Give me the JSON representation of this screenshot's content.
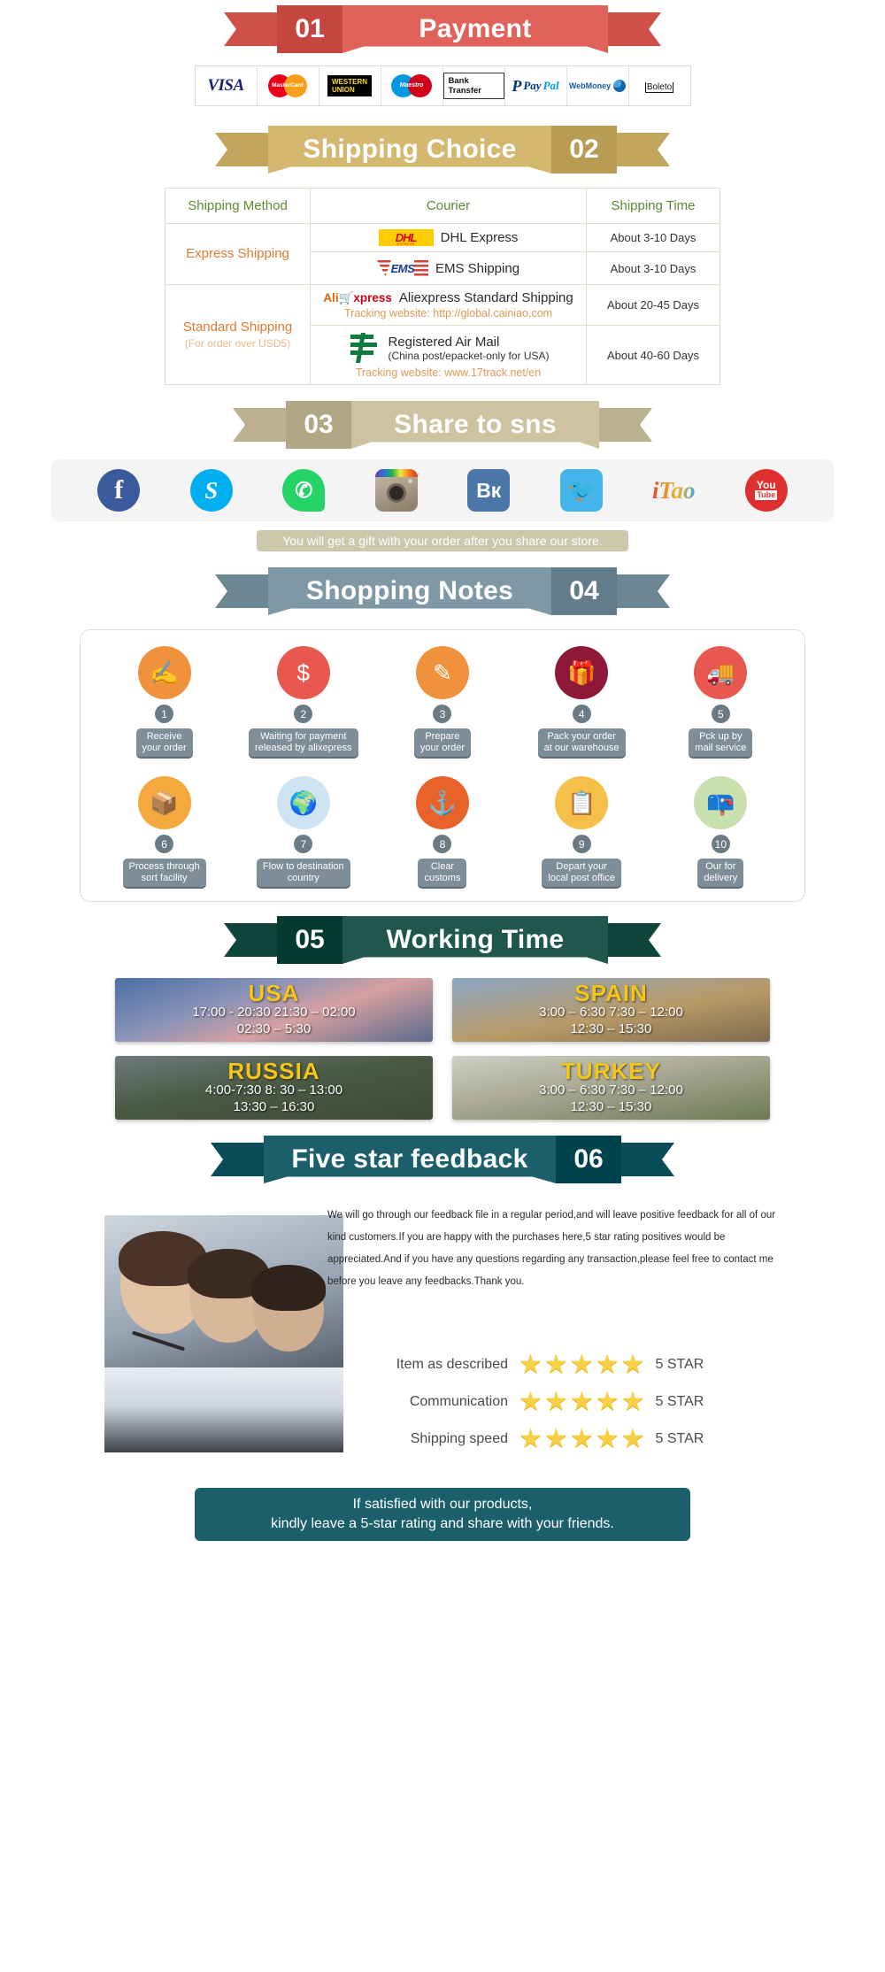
{
  "sections": {
    "payment": {
      "number": "01",
      "title": "Payment",
      "color": "#e0625a",
      "methods": [
        {
          "name": "visa-logo",
          "label": "VISA"
        },
        {
          "name": "mastercard-logo",
          "label": "MasterCard"
        },
        {
          "name": "western-union-logo",
          "line1": "WESTERN",
          "line2": "UNION"
        },
        {
          "name": "maestro-logo",
          "label": "Maestro"
        },
        {
          "name": "bank-transfer-logo",
          "label": "Bank Transfer"
        },
        {
          "name": "paypal-logo",
          "label": "PayPal",
          "part1": "Pay",
          "part2": "Pal"
        },
        {
          "name": "webmoney-logo",
          "label": "WebMoney"
        },
        {
          "name": "boleto-logo",
          "label": "Boleto"
        }
      ]
    },
    "shipping": {
      "number": "02",
      "title": "Shipping Choice",
      "color": "#d4b870",
      "headers": [
        "Shipping Method",
        "Courier",
        "Shipping Time"
      ],
      "groups": [
        {
          "method": "Express Shipping",
          "method_sub": "",
          "rows": [
            {
              "logo": "dhl",
              "courier": "DHL Express",
              "courier_sub": "",
              "track": "",
              "time": "About 3-10 Days"
            },
            {
              "logo": "ems",
              "courier": "EMS Shipping",
              "courier_sub": "",
              "track": "",
              "time": "About 3-10 Days"
            }
          ]
        },
        {
          "method": "Standard Shipping",
          "method_sub": "(For order over USD5)",
          "rows": [
            {
              "logo": "aliexpress",
              "courier": "Aliexpress Standard Shipping",
              "courier_sub": "",
              "track": "Tracking website: http://global.cainiao.com",
              "time": "About 20-45 Days"
            },
            {
              "logo": "chinapost",
              "courier": "Registered Air Mail",
              "courier_sub": "(China post/epacket-only for USA)",
              "track": "Tracking website: www.17track.net/en",
              "time": "About 40-60 Days"
            }
          ]
        }
      ]
    },
    "share": {
      "number": "03",
      "title": "Share to sns",
      "color": "#cdc3a1",
      "icons": [
        {
          "name": "facebook-icon",
          "glyph": "f"
        },
        {
          "name": "skype-icon",
          "glyph": "S"
        },
        {
          "name": "whatsapp-icon",
          "glyph": "✆"
        },
        {
          "name": "instagram-icon",
          "glyph": ""
        },
        {
          "name": "vk-icon",
          "glyph": "Вк"
        },
        {
          "name": "twitter-icon",
          "glyph": "ᵗ"
        },
        {
          "name": "itao-icon",
          "glyph": "iTao"
        },
        {
          "name": "youtube-icon",
          "glyph": "You",
          "glyph2": "Tube"
        }
      ],
      "note": "You will get a gift with your order after you share our store."
    },
    "notes": {
      "number": "04",
      "title": "Shopping Notes",
      "color": "#7f98a6",
      "steps": [
        {
          "num": "1",
          "label": "Receive\nyour order",
          "icon": "document-hand-icon",
          "color": "#f0923c"
        },
        {
          "num": "2",
          "label": "Waiting for payment\nreleased by alixepress",
          "icon": "money-bag-icon",
          "color": "#e9584f"
        },
        {
          "num": "3",
          "label": "Prepare\nyour order",
          "icon": "document-pen-icon",
          "color": "#f0923c"
        },
        {
          "num": "4",
          "label": "Pack your order\nat our warehouse",
          "icon": "gift-box-icon",
          "color": "#8e1838"
        },
        {
          "num": "5",
          "label": "Pck up by\nmail service",
          "icon": "mail-truck-icon",
          "color": "#e9584f"
        },
        {
          "num": "6",
          "label": "Process through\nsort facility",
          "icon": "parcel-cart-icon",
          "color": "#f4a93c"
        },
        {
          "num": "7",
          "label": "Flow to destination\ncountry",
          "icon": "globe-icon",
          "color": "#cfe4f2"
        },
        {
          "num": "8",
          "label": "Clear\ncustoms",
          "icon": "customs-anchor-icon",
          "color": "#e8622a"
        },
        {
          "num": "9",
          "label": "Depart your\nlocal post office",
          "icon": "postman-icon",
          "color": "#f5c04a"
        },
        {
          "num": "10",
          "label": "Our for\ndelivery",
          "icon": "package-icon",
          "color": "#c8dfae"
        }
      ]
    },
    "working_time": {
      "number": "05",
      "title": "Working Time",
      "color": "#20574d",
      "cards": [
        {
          "country": "USA",
          "line1": "17:00 - 20:30  21:30 – 02:00",
          "line2": "02:30 – 5:30",
          "bg": "bg-usa"
        },
        {
          "country": "SPAIN",
          "line1": "3:00 –  6:30   7:30 –  12:00",
          "line2": "12:30 – 15:30",
          "bg": "bg-spain"
        },
        {
          "country": "RUSSIA",
          "line1": "4:00-7:30   8: 30 – 13:00",
          "line2": "13:30 – 16:30",
          "bg": "bg-russia"
        },
        {
          "country": "TURKEY",
          "line1": "3:00 –  6:30   7:30 –  12:00",
          "line2": "12:30 – 15:30",
          "bg": "bg-turkey"
        }
      ]
    },
    "feedback": {
      "number": "06",
      "title": "Five star feedback",
      "color": "#1b5f6b",
      "paragraph": "We will go through our feedback file in a regular period,and will leave positive feedback for all of our kind customers.If you are happy with the purchases here,5 star rating positives would be appreciated.And if you have any questions regarding any transaction,please feel free to contact me before you leave any feedbacks.Thank you.",
      "ratings": [
        {
          "label": "Item as described",
          "stars": 5,
          "score": "5 STAR"
        },
        {
          "label": "Communication",
          "stars": 5,
          "score": "5 STAR"
        },
        {
          "label": "Shipping speed",
          "stars": 5,
          "score": "5 STAR"
        }
      ],
      "star_glyph": "★",
      "bottom_line1": "If satisfied with our products,",
      "bottom_line2": "kindly leave a 5-star rating and share with your friends."
    }
  }
}
